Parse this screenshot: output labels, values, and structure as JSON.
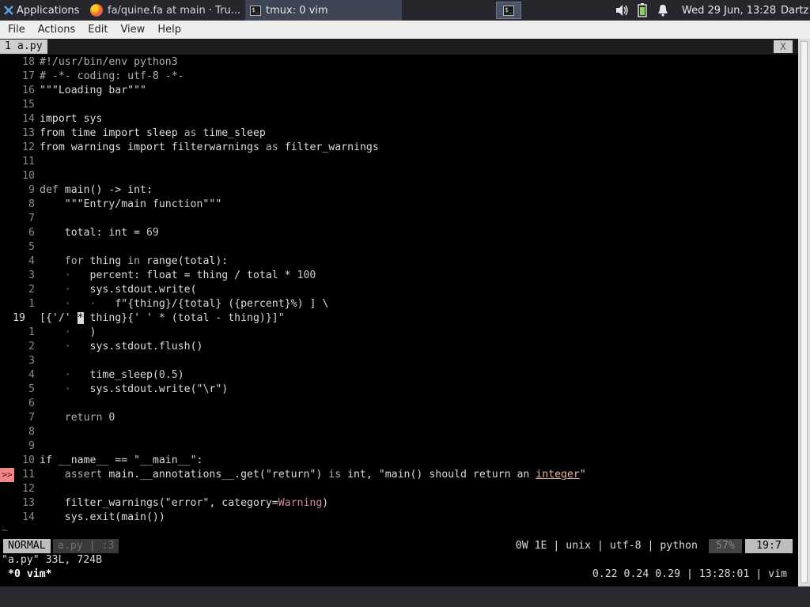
{
  "panel": {
    "applications": "Applications",
    "task_firefox": "fa/quine.fa at main · Tru...",
    "task_terminal": "tmux: 0 vim",
    "clock": "Wed 29 Jun, 13:28",
    "user": "Dartz"
  },
  "menu": {
    "file": "File",
    "actions": "Actions",
    "edit": "Edit",
    "view": "View",
    "help": "Help"
  },
  "tab": {
    "label": "1  a.py",
    "close": "X"
  },
  "lines": [
    {
      "ln": "18",
      "html": "<span class='c'>#!/usr/bin/env python3</span>"
    },
    {
      "ln": "17",
      "html": "<span class='c'># -*- coding: utf-8 -*-</span>"
    },
    {
      "ln": "16",
      "html": "<span class='s'>\"\"\"Loading bar\"\"\"</span>"
    },
    {
      "ln": "15",
      "html": ""
    },
    {
      "ln": "14",
      "html": "<span class='k'>import</span> sys"
    },
    {
      "ln": "13",
      "html": "<span class='k'>from</span> time <span class='k'>import</span> sleep <span class='c'>as</span> time_sleep"
    },
    {
      "ln": "12",
      "html": "<span class='k'>from</span> warnings <span class='k'>import</span> filterwarnings <span class='c'>as</span> filter_warnings"
    },
    {
      "ln": "11",
      "html": ""
    },
    {
      "ln": "10",
      "html": ""
    },
    {
      "ln": "9",
      "html": "<span class='c'>def</span> main() -&gt; int:"
    },
    {
      "ln": "8",
      "html": "    <span class='s'>\"\"\"Entry/main function\"\"\"</span>"
    },
    {
      "ln": "7",
      "html": ""
    },
    {
      "ln": "6",
      "html": "    total: int = <span class='n'>69</span>"
    },
    {
      "ln": "5",
      "html": ""
    },
    {
      "ln": "4",
      "html": "    <span class='c'>for</span> thing <span class='c'>in</span> range(total):"
    },
    {
      "ln": "3",
      "html": "    <span class='dim'>·</span>   percent: float = thing / total * <span class='n'>100</span>"
    },
    {
      "ln": "2",
      "html": "    <span class='dim'>·</span>   sys.stdout.write("
    },
    {
      "ln": "1",
      "html": "    <span class='dim'>·</span>   <span class='dim'>·</span>   <span class='s'>f\"{thing}/{total} ({percent}%) ] \\</span>"
    },
    {
      "ln": "19",
      "cur": true,
      "html": "<span class='s'>[{'/' </span><span class='cursor'>*</span><span class='s'> thing}{' ' * (total - thing)}]\"</span>"
    },
    {
      "ln": "1",
      "html": "    <span class='dim'>·</span>   )"
    },
    {
      "ln": "2",
      "html": "    <span class='dim'>·</span>   sys.stdout.flush()"
    },
    {
      "ln": "3",
      "html": ""
    },
    {
      "ln": "4",
      "html": "    <span class='dim'>·</span>   time_sleep(<span class='n'>0.5</span>)"
    },
    {
      "ln": "5",
      "html": "    <span class='dim'>·</span>   sys.stdout.write(<span class='s'>\"\\r\"</span>)"
    },
    {
      "ln": "6",
      "html": ""
    },
    {
      "ln": "7",
      "html": "    <span class='c'>return</span> <span class='n'>0</span>"
    },
    {
      "ln": "8",
      "html": ""
    },
    {
      "ln": "9",
      "html": ""
    },
    {
      "ln": "10",
      "html": "<span class='k'>if</span> __name__ == <span class='s'>\"__main__\"</span>:"
    },
    {
      "ln": "11",
      "sign": ">>",
      "html": "    <span class='c'>assert</span> main.__annotations__.get(<span class='s'>\"return\"</span>) <span class='c'>is</span> int, <span class='s'>\"main() should return an </span><span class='ul'>integer</span><span class='s'>\"</span>"
    },
    {
      "ln": "12",
      "html": ""
    },
    {
      "ln": "13",
      "html": "    filter_warnings(<span class='s'>\"error\"</span>, category=<span class='warn'>Warning</span>)"
    },
    {
      "ln": "14",
      "html": "    sys.exit(main())"
    }
  ],
  "tilde": "~",
  "status": {
    "mode": "NORMAL",
    "file": "a.py  |  :3",
    "info": "0W 1E  |  unix  |  utf-8  |  python",
    "percent": "57%",
    "position": "19:7"
  },
  "message": "\"a.py\" 33L, 724B",
  "tmux": {
    "window": "*0 vim*",
    "right": "0.22 0.24 0.29  |  13:28:01  |  vim"
  }
}
